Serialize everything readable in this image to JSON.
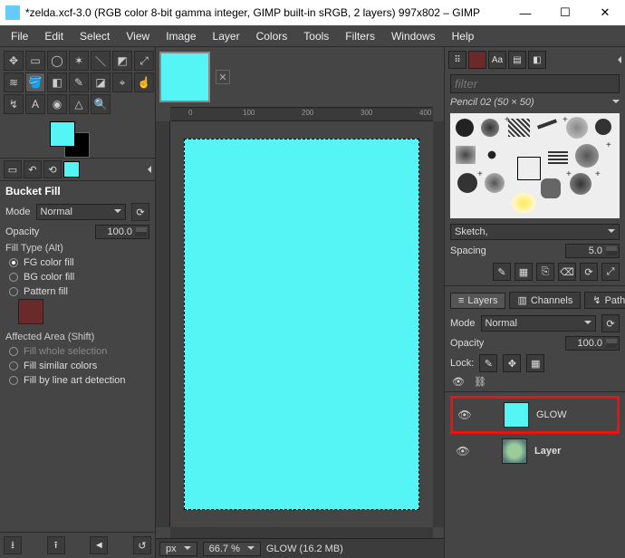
{
  "window": {
    "title": "*zelda.xcf-3.0 (RGB color 8-bit gamma integer, GIMP built-in sRGB, 2 layers) 997x802 – GIMP",
    "minimize": "—",
    "maximize": "☐",
    "close": "✕"
  },
  "menu": [
    "File",
    "Edit",
    "Select",
    "View",
    "Image",
    "Layer",
    "Colors",
    "Tools",
    "Filters",
    "Windows",
    "Help"
  ],
  "toolbox": {
    "section": "Bucket Fill",
    "mode_label": "Mode",
    "mode_value": "Normal",
    "opacity_label": "Opacity",
    "opacity_value": "100.0",
    "filltype_label": "Fill Type  (Alt)",
    "fg": "FG color fill",
    "bg": "BG color fill",
    "pat": "Pattern fill",
    "affected_label": "Affected Area  (Shift)",
    "a1": "Fill whole selection",
    "a2": "Fill similar colors",
    "a3": "Fill by line art detection"
  },
  "canvas": {
    "ruler_ticks": [
      "0",
      "100",
      "200",
      "300",
      "400"
    ]
  },
  "status": {
    "unit": "px",
    "zoom": "66.7 %",
    "layer": "GLOW (16.2 MB)"
  },
  "right": {
    "filter_placeholder": "filter",
    "brush_name": "Pencil 02 (50 × 50)",
    "sketch_label": "Sketch,",
    "spacing_label": "Spacing",
    "spacing_value": "5.0",
    "tabs": {
      "layers": "Layers",
      "channels": "Channels",
      "paths": "Paths"
    },
    "mode_label": "Mode",
    "mode_value": "Normal",
    "opacity_label": "Opacity",
    "opacity_value": "100.0",
    "lock_label": "Lock:",
    "layers": [
      {
        "name": "GLOW"
      },
      {
        "name": "Layer"
      }
    ]
  }
}
